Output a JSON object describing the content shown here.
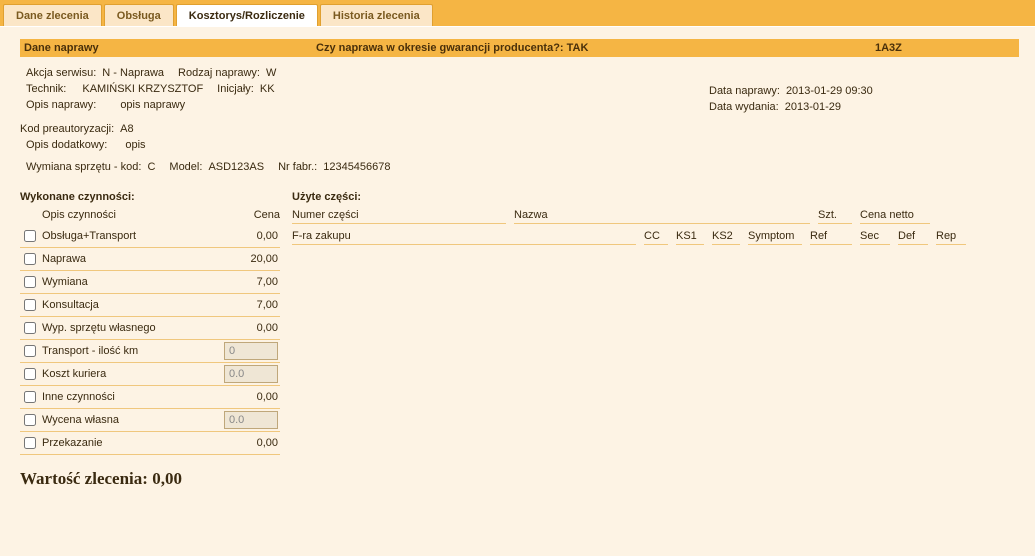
{
  "tabs": [
    {
      "label": "Dane zlecenia",
      "active": false
    },
    {
      "label": "Obsługa",
      "active": false
    },
    {
      "label": "Kosztorys/Rozliczenie",
      "active": true
    },
    {
      "label": "Historia zlecenia",
      "active": false
    }
  ],
  "header": {
    "dane_naprawy": "Dane naprawy",
    "czy_gwar": "Czy naprawa w okresie gwarancji producenta?: TAK",
    "code": "1A3Z"
  },
  "info": {
    "akcja_k": "Akcja serwisu:",
    "akcja_v": "N - Naprawa",
    "rodzaj_k": "Rodzaj naprawy:",
    "rodzaj_v": "W",
    "technik_k": "Technik:",
    "technik_v": "KAMIŃSKI KRZYSZTOF",
    "inic_k": "Inicjały:",
    "inic_v": "KK",
    "opis_k": "Opis naprawy:",
    "opis_v": "opis naprawy",
    "kod_k": "Kod preautoryzacji:",
    "kod_v": "A8",
    "opisd_k": "Opis dodatkowy:",
    "opisd_v": "opis",
    "wym_k": "Wymiana sprzętu - kod:",
    "wym_v": "C",
    "model_k": "Model:",
    "model_v": "ASD123AS",
    "nrfab_k": "Nr fabr.:",
    "nrfab_v": "12345456678",
    "datan_k": "Data naprawy:",
    "datan_v": "2013-01-29 09:30",
    "dataw_k": "Data wydania:",
    "dataw_v": "2013-01-29"
  },
  "activities": {
    "title": "Wykonane czynności:",
    "col_opis": "Opis czynności",
    "col_cena": "Cena",
    "rows": [
      {
        "name": "Obsługa+Transport",
        "price": "0,00"
      },
      {
        "name": "Naprawa",
        "price": "20,00"
      },
      {
        "name": "Wymiana",
        "price": "7,00"
      },
      {
        "name": "Konsultacja",
        "price": "7,00"
      },
      {
        "name": "Wyp. sprzętu własnego",
        "price": "0,00"
      },
      {
        "name": "Transport - ilość km",
        "input": "0"
      },
      {
        "name": "Koszt kuriera",
        "input": "0.0"
      },
      {
        "name": "Inne czynności",
        "price": "0,00"
      },
      {
        "name": "Wycena własna",
        "input": "0.0"
      },
      {
        "name": "Przekazanie",
        "price": "0,00"
      }
    ]
  },
  "parts": {
    "title": "Użyte części:",
    "h_numer": "Numer części",
    "h_nazwa": "Nazwa",
    "h_szt": "Szt.",
    "h_cena": "Cena netto",
    "h_fra": "F-ra zakupu",
    "h_cc": "CC",
    "h_ks1": "KS1",
    "h_ks2": "KS2",
    "h_sym": "Symptom",
    "h_ref": "Ref",
    "h_sec": "Sec",
    "h_def": "Def",
    "h_rep": "Rep"
  },
  "total_label": "Wartość zlecenia",
  "total_value": "0,00"
}
